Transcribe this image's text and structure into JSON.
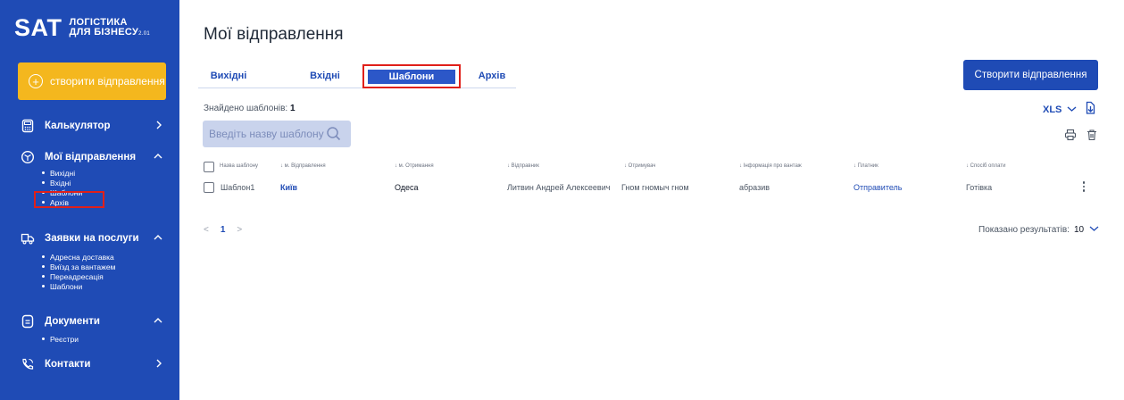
{
  "sidebar": {
    "logo": {
      "main": "SAT",
      "line1": "ЛОГІСТИКА",
      "line2": "ДЛЯ БІЗНЕСУ",
      "version": "2.01"
    },
    "create_label": "створити відправлення",
    "items": [
      {
        "label": "Калькулятор",
        "icon": "calculator-icon",
        "chevron": ">"
      },
      {
        "label": "Мої відправлення",
        "icon": "box-icon",
        "chevron": "^",
        "sub": [
          "Вихідні",
          "Вхідні",
          "Шаблони",
          "Архів"
        ]
      },
      {
        "label": "Заявки на послуги",
        "icon": "truck-icon",
        "chevron": "^",
        "sub": [
          "Адресна доставка",
          "Виїзд за вантажем",
          "Переадресація",
          "Шаблони"
        ]
      },
      {
        "label": "Документи",
        "icon": "document-icon",
        "chevron": "^",
        "sub": [
          "Реєстри"
        ]
      },
      {
        "label": "Контакти",
        "icon": "phone-icon",
        "chevron": ">"
      }
    ]
  },
  "main": {
    "title": "Мої відправлення",
    "tabs": [
      "Вихідні",
      "Вхідні",
      "Шаблони",
      "Архів"
    ],
    "active_tab": "Шаблони",
    "create_button": "Створити відправлення",
    "found_label": "Знайдено шаблонів:",
    "found_count": "1",
    "search_placeholder": "Введіть назву шаблону",
    "export_label": "XLS",
    "columns": [
      "Назва шаблону",
      "м. Відправлення",
      "м. Отримання",
      "Відправник",
      "Отримувач",
      "Інформація про вантаж",
      "Платник",
      "Спосіб оплати"
    ],
    "rows": [
      {
        "name": "Шаблон1",
        "from": "Київ",
        "to": "Одеса",
        "sender": "Литвин Андрей Алексеевич",
        "receiver": "Гном гномыч гном",
        "cargo": "абразив",
        "payer": "Отправитель",
        "payment": "Готівка"
      }
    ],
    "pagination": {
      "prev": "<",
      "page": "1",
      "next": ">"
    },
    "shown_label": "Показано результатів:",
    "shown_value": "10"
  },
  "colors": {
    "sidebar": "#1f4bb5",
    "accent_yellow": "#f4b71e",
    "highlight_red": "#e0201a",
    "primary": "#1f4bb5"
  }
}
